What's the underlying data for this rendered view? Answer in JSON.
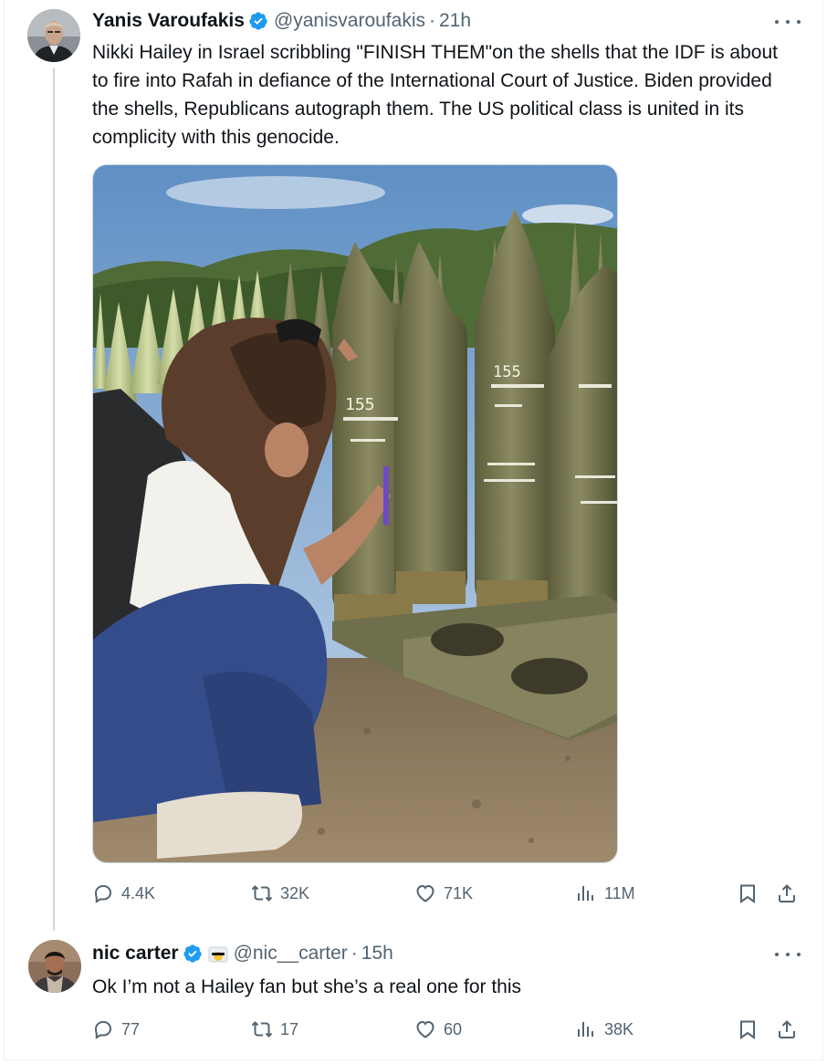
{
  "tweet1": {
    "author_name": "Yanis Varoufakis",
    "handle": "@yanisvaroufakis",
    "separator": "·",
    "time": "21h",
    "text": "Nikki Hailey in Israel scribbling \"FINISH THEM\"on the shells that the IDF is about to fire into Rafah in defiance of the International Court of Justice. Biden provided the shells, Republicans autograph them. The US political class is united in its complicity with this genocide.",
    "replies": "4.4K",
    "retweets": "32K",
    "likes": "71K",
    "views": "11M",
    "shell_marking": "155"
  },
  "tweet2": {
    "author_name": "nic carter",
    "handle": "@nic__carter",
    "separator": "·",
    "time": "15h",
    "text": "Ok I’m not a Hailey fan but she’s a real one for this",
    "replies": "77",
    "retweets": "17",
    "likes": "60",
    "views": "38K"
  },
  "icons": {
    "verified": "verified-badge-icon",
    "more": "more-options-icon",
    "reply": "reply-icon",
    "retweet": "retweet-icon",
    "like": "heart-icon",
    "views": "views-chart-icon",
    "bookmark": "bookmark-icon",
    "share": "share-icon"
  },
  "colors": {
    "text": "#0f1419",
    "secondary": "#536471",
    "verified": "#1d9bf0",
    "border": "#cfd9de"
  }
}
